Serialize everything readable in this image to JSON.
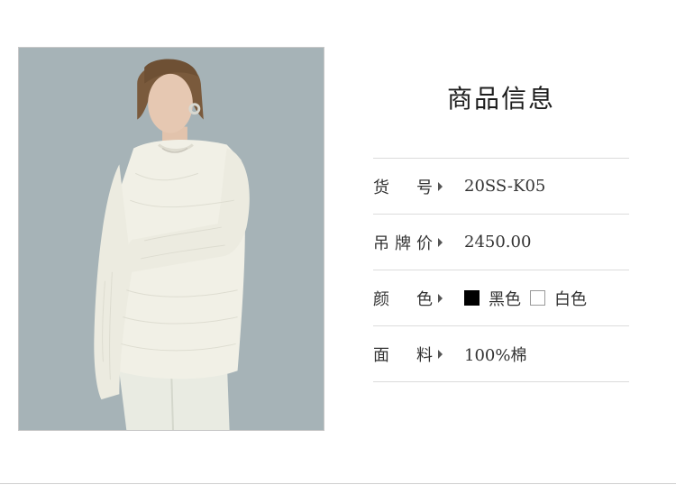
{
  "section_title": "商品信息",
  "product_image": {
    "description_icon": "model-wearing-white-knit-sweater-photo"
  },
  "specs": [
    {
      "label": "货　号",
      "value": "20SS-K05"
    },
    {
      "label": "吊牌价",
      "value": "2450.00"
    },
    {
      "label": "颜　色",
      "colors": [
        {
          "name": "黑色",
          "swatch": "#000000"
        },
        {
          "name": "白色",
          "swatch": "#ffffff"
        }
      ]
    },
    {
      "label": "面　料",
      "value": "100%棉"
    }
  ],
  "colors": {
    "background": "#ffffff",
    "photo_backdrop": "#a6b3b7",
    "divider": "#dcdcdc",
    "text": "#333333"
  }
}
